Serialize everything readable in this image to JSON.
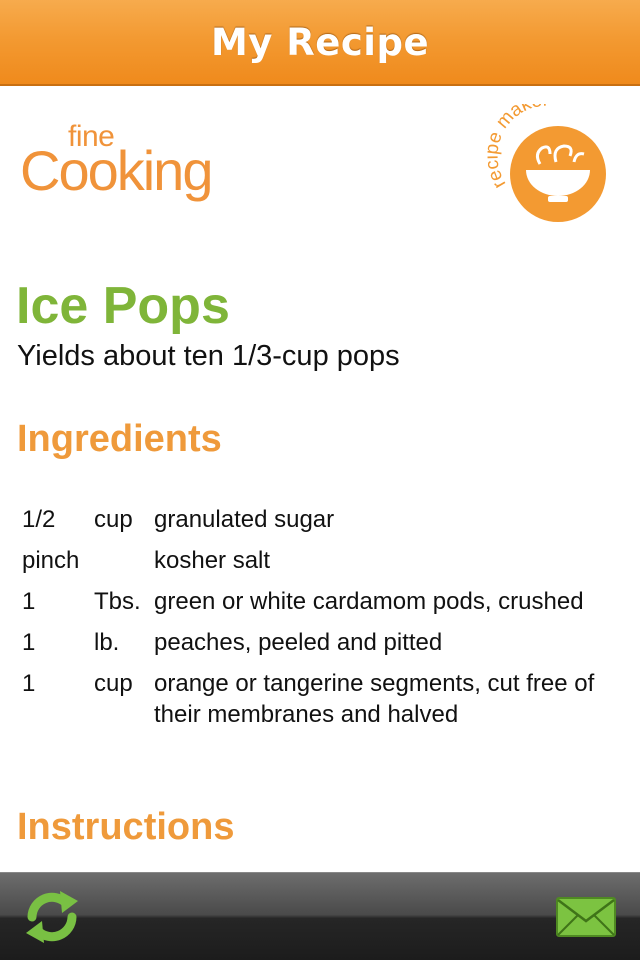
{
  "nav": {
    "title": "My Recipe"
  },
  "brand": {
    "small": "fine",
    "big": "Cooking"
  },
  "badge": {
    "text": "recipe maker",
    "color": "#f39a32"
  },
  "recipe": {
    "title": "Ice Pops",
    "yield": "Yields about ten 1/3-cup pops",
    "ingredients_heading": "Ingredients",
    "instructions_heading": "Instructions",
    "ingredients": [
      {
        "qty": "1/2",
        "unit": "cup",
        "item": "granulated sugar"
      },
      {
        "qty": "pinch",
        "unit": "",
        "item": "kosher salt"
      },
      {
        "qty": "1",
        "unit": "Tbs.",
        "item": "green or white cardamom pods, crushed"
      },
      {
        "qty": "1",
        "unit": "lb.",
        "item": "peaches, peeled and pitted"
      },
      {
        "qty": "1",
        "unit": "cup",
        "item": "orange or tangerine segments, cut free of their membranes and halved"
      }
    ]
  },
  "toolbar": {
    "left_icon": "refresh-icon",
    "right_icon": "mail-icon"
  },
  "colors": {
    "accent": "#f39a32",
    "title_green": "#7fb539",
    "heading_orange": "#ef9a3b"
  }
}
